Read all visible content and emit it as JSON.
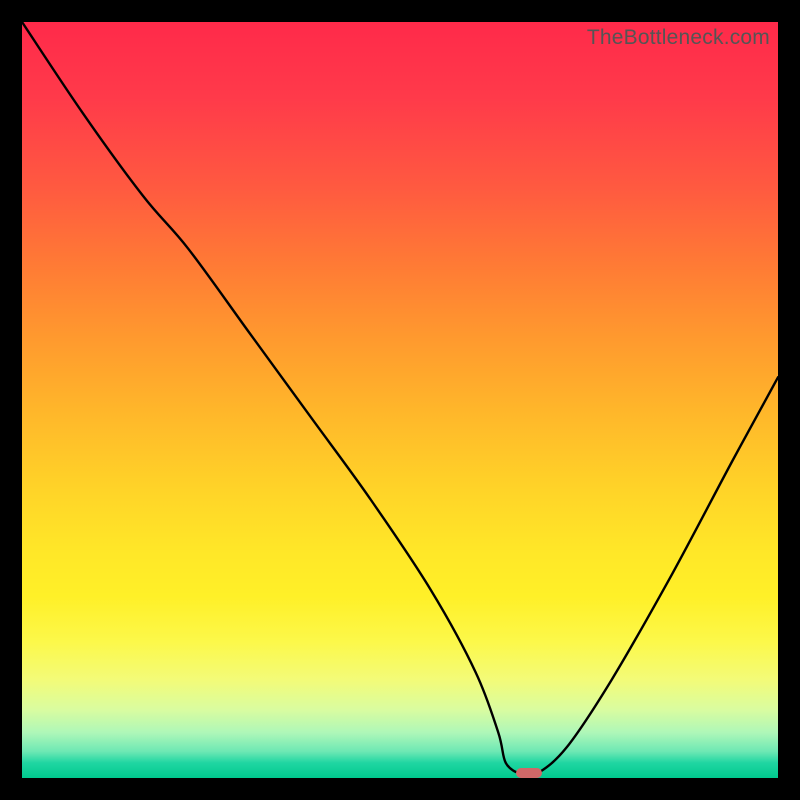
{
  "watermark": "TheBottleneck.com",
  "chart_data": {
    "type": "line",
    "title": "",
    "xlabel": "",
    "ylabel": "",
    "xlim": [
      0,
      100
    ],
    "ylim": [
      0,
      100
    ],
    "grid": false,
    "legend": false,
    "background": "heatmap-gradient-red-to-green-vertical",
    "series": [
      {
        "name": "bottleneck-curve",
        "color": "#000000",
        "x": [
          0,
          8,
          16,
          22,
          30,
          38,
          46,
          54,
          60,
          63,
          64,
          66,
          68,
          72,
          78,
          86,
          94,
          100
        ],
        "y": [
          100,
          88,
          77,
          70,
          59,
          48,
          37,
          25,
          14,
          6,
          2,
          0.5,
          0.5,
          4,
          13,
          27,
          42,
          53
        ]
      }
    ],
    "marker": {
      "x": 67,
      "y": 0.6,
      "color": "#d06868",
      "shape": "rounded-rect"
    }
  }
}
